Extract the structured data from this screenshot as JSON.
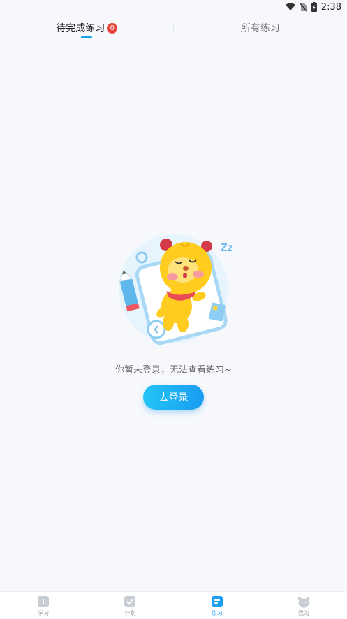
{
  "status_bar": {
    "time": "2:38",
    "icons": [
      "wifi-icon",
      "no-sim-icon",
      "battery-charging-icon"
    ]
  },
  "tabs": [
    {
      "label": "待完成练习",
      "badge": "0",
      "active": true
    },
    {
      "label": "所有练习",
      "active": false
    }
  ],
  "empty_state": {
    "illustration": "sleeping-lion-mascot",
    "zz_text": "Zz",
    "message": "你暂未登录，无法查看练习~",
    "button_label": "去登录"
  },
  "bottom_nav": {
    "items": [
      {
        "label": "学习",
        "icon": "book-icon",
        "active": false
      },
      {
        "label": "计划",
        "icon": "plan-check-icon",
        "active": false
      },
      {
        "label": "练习",
        "icon": "practice-icon",
        "active": true
      },
      {
        "label": "我的",
        "icon": "profile-icon",
        "active": false
      }
    ]
  },
  "colors": {
    "accent": "#1aa0f5",
    "badge": "#e8453c",
    "background": "#f6f8fb"
  }
}
